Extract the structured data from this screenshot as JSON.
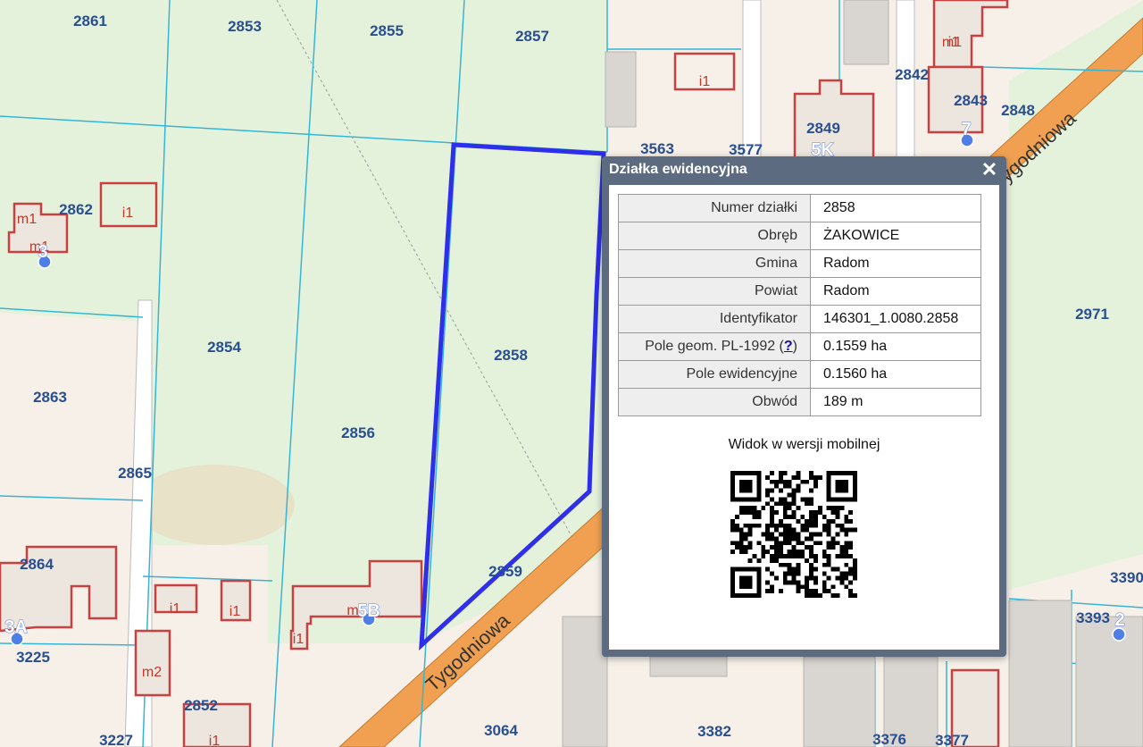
{
  "map": {
    "parcels": [
      "2861",
      "2853",
      "2855",
      "2857",
      "2862",
      "2854",
      "2858",
      "2863",
      "2856",
      "2865",
      "2864",
      "2859",
      "3225",
      "2852",
      "3227",
      "3064",
      "3382",
      "3376",
      "3377",
      "3393",
      "3390",
      "2971",
      "2842",
      "2843",
      "2848",
      "3563",
      "3577",
      "2849"
    ],
    "building_labels": [
      "i1",
      "i1",
      "m1",
      "i1",
      "i1",
      "i1",
      "m2",
      "m",
      "i1",
      "i1",
      "m1",
      "m1"
    ],
    "house_numbers": [
      "3",
      "3A",
      "5B",
      "5K",
      "7",
      "2"
    ],
    "streets": [
      "Tygodniowa",
      "ygodniowa"
    ],
    "colors": {
      "selection": "#2f2ee8",
      "parcel_line": "#35b5d6",
      "building": "#c94040",
      "road": "#f0a050"
    }
  },
  "popup": {
    "title": "Działka ewidencyjna",
    "close_symbol": "✕",
    "rows": [
      {
        "label": "Numer działki",
        "value": "2858"
      },
      {
        "label": "Obręb",
        "value": "ŻAKOWICE"
      },
      {
        "label": "Gmina",
        "value": "Radom"
      },
      {
        "label": "Powiat",
        "value": "Radom"
      },
      {
        "label": "Identyfikator",
        "value": "146301_1.0080.2858"
      },
      {
        "label": "Pole geom. PL-1992 (",
        "help_link": "?",
        "label_end": ")",
        "value": "0.1559 ha"
      },
      {
        "label": "Pole ewidencyjne",
        "value": "0.1560 ha"
      },
      {
        "label": "Obwód",
        "value": "189 m"
      }
    ],
    "mobile_caption": "Widok w wersji mobilnej",
    "qr_icon": "qr-code-icon"
  }
}
